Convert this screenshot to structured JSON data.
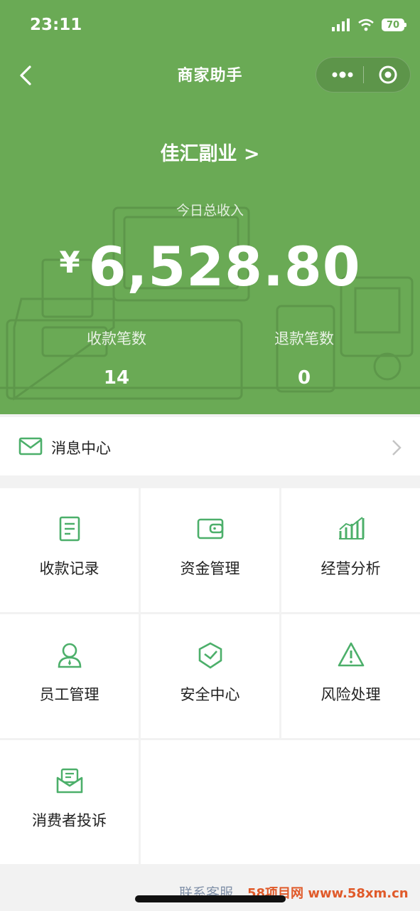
{
  "status_bar": {
    "time": "23:11",
    "battery": "70"
  },
  "nav": {
    "title": "商家助手"
  },
  "merchant": {
    "name": "佳汇副业 >"
  },
  "income": {
    "label": "今日总收入",
    "currency": "¥",
    "amount": "6,528.80"
  },
  "stats": [
    {
      "label": "收款笔数",
      "value": "14"
    },
    {
      "label": "退款笔数",
      "value": "0"
    }
  ],
  "message_center": {
    "label": "消息中心"
  },
  "grid": [
    {
      "label": "收款记录",
      "icon": "receipt-icon"
    },
    {
      "label": "资金管理",
      "icon": "wallet-icon"
    },
    {
      "label": "经营分析",
      "icon": "bar-chart-icon"
    },
    {
      "label": "员工管理",
      "icon": "staff-icon"
    },
    {
      "label": "安全中心",
      "icon": "shield-icon"
    },
    {
      "label": "风险处理",
      "icon": "warning-icon"
    },
    {
      "label": "消费者投诉",
      "icon": "complaint-mail-icon"
    }
  ],
  "footer": {
    "contact": "联系客服",
    "watermark": "58项目网 www.58xm.cn"
  },
  "colors": {
    "brand_green": "#6aaa55",
    "icon_green": "#4caf6a"
  }
}
